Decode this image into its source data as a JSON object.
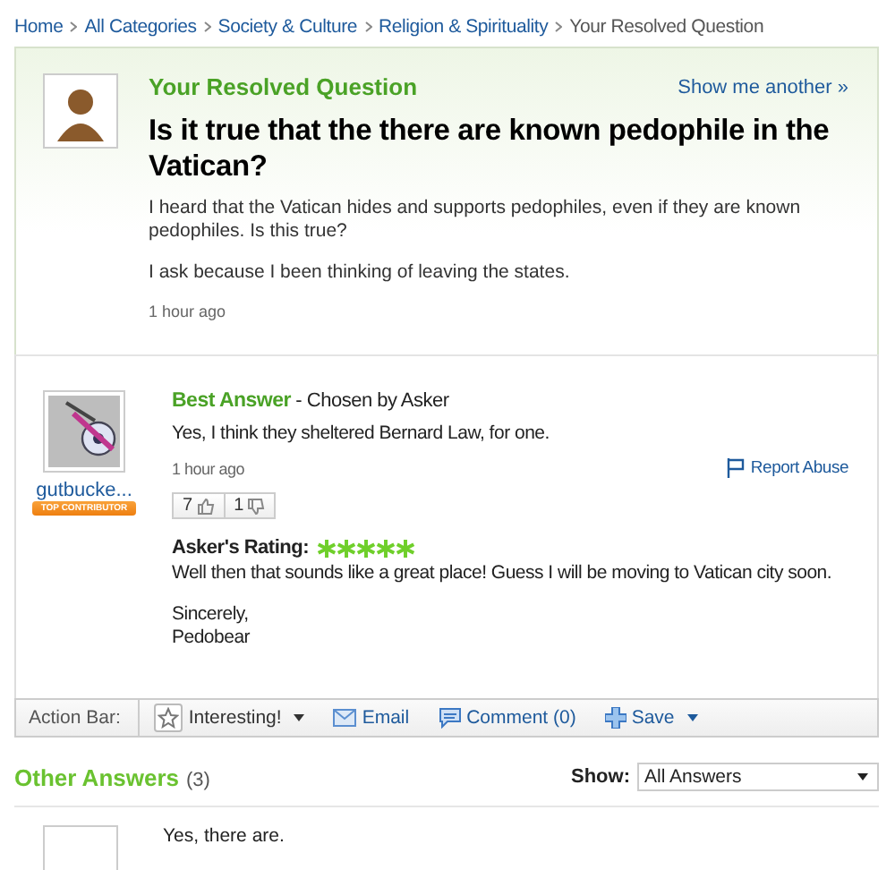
{
  "breadcrumb": [
    {
      "label": "Home",
      "link": true
    },
    {
      "label": "All Categories",
      "link": true
    },
    {
      "label": "Society & Culture",
      "link": true
    },
    {
      "label": "Religion & Spirituality",
      "link": true
    },
    {
      "label": "Your Resolved Question",
      "link": false
    }
  ],
  "question": {
    "heading": "Your Resolved Question",
    "show_another": "Show me another »",
    "title": "Is it true that the there are known pedophile in the Vatican?",
    "body": [
      "I heard that the Vatican hides and supports pedophiles, even if they are known pedophiles. Is this true?",
      "I ask because I been thinking of leaving the states."
    ],
    "time": "1 hour ago"
  },
  "best_answer": {
    "user": "gutbucke...",
    "badge": "TOP CONTRIBUTOR",
    "label": "Best Answer",
    "chosen": "- Chosen by Asker",
    "text": "Yes, I think they sheltered Bernard Law, for one.",
    "time": "1 hour ago",
    "report": "Report Abuse",
    "thumbs_up": "7",
    "thumbs_down": "1",
    "rating_label": "Asker's Rating:",
    "stars": 5,
    "comment": [
      "Well then that sounds like a great place! Guess I will be moving to Vatican city soon.",
      "Sincerely,\nPedobear"
    ]
  },
  "action_bar": {
    "label": "Action Bar:",
    "actions": [
      {
        "label": "Interesting!",
        "kind": "star",
        "menu": true
      },
      {
        "label": "Email",
        "kind": "mail",
        "menu": false
      },
      {
        "label": "Comment (0)",
        "kind": "comment",
        "menu": false
      },
      {
        "label": "Save",
        "kind": "plus",
        "menu": true
      }
    ]
  },
  "other_answers": {
    "heading": "Other Answers",
    "count": "(3)",
    "show_label": "Show:",
    "filter": "All Answers",
    "answers": [
      {
        "text": "Yes, there are."
      }
    ]
  }
}
